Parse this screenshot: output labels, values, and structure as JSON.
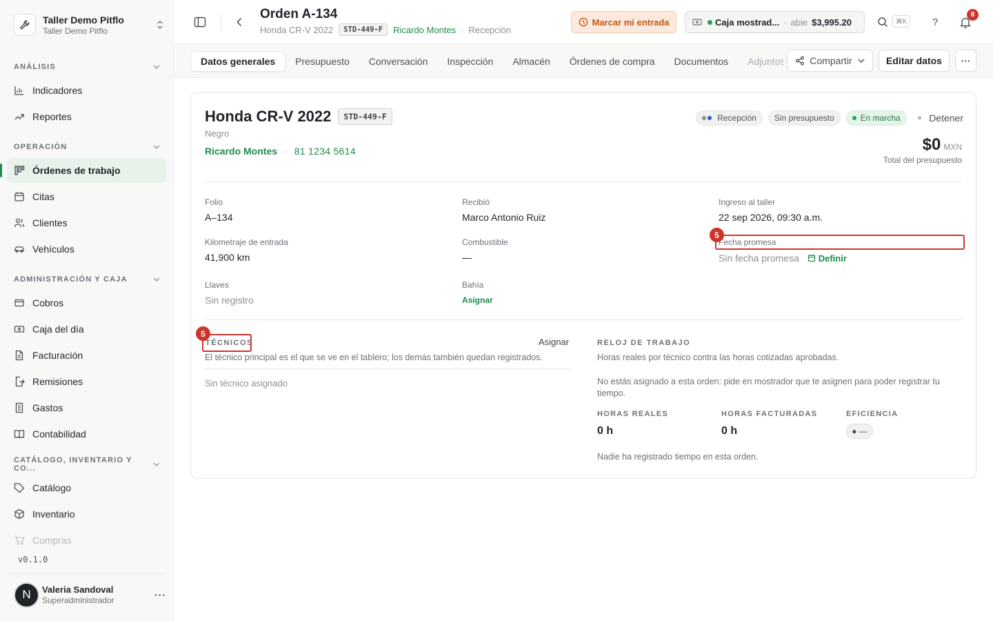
{
  "org": {
    "name": "Taller Demo Pitflo",
    "sub": "Taller Demo Pitflo"
  },
  "sidebar": {
    "sections": [
      {
        "title": "ANÁLISIS"
      },
      {
        "title": "OPERACIÓN"
      },
      {
        "title": "ADMINISTRACIÓN Y CAJA"
      },
      {
        "title": "CATÁLOGO, INVENTARIO Y CO..."
      }
    ],
    "items": [
      {
        "label": "Indicadores",
        "icon": "bar-chart-icon"
      },
      {
        "label": "Reportes",
        "icon": "trend-icon"
      },
      {
        "label": "Órdenes de trabajo",
        "icon": "kanban-icon"
      },
      {
        "label": "Citas",
        "icon": "calendar-icon"
      },
      {
        "label": "Clientes",
        "icon": "users-icon"
      },
      {
        "label": "Vehículos",
        "icon": "car-icon"
      },
      {
        "label": "Cobros",
        "icon": "wallet-icon"
      },
      {
        "label": "Caja del día",
        "icon": "cash-icon"
      },
      {
        "label": "Facturación",
        "icon": "invoice-icon"
      },
      {
        "label": "Remisiones",
        "icon": "export-doc-icon"
      },
      {
        "label": "Gastos",
        "icon": "receipt-icon"
      },
      {
        "label": "Contabilidad",
        "icon": "book-icon"
      },
      {
        "label": "Catálogo",
        "icon": "tag-icon"
      },
      {
        "label": "Inventario",
        "icon": "box-icon"
      },
      {
        "label": "Compras",
        "icon": "cart-icon"
      }
    ],
    "version": "v0.1.0"
  },
  "user": {
    "initial": "N",
    "name": "Valeria Sandoval",
    "role": "Superadministrador",
    "more": "···"
  },
  "header": {
    "title": "Orden A-134",
    "vehicle": "Honda CR-V 2022",
    "plate": "STD-449-F",
    "customer": "Ricardo Montes",
    "sep": "·",
    "stage": "Recepción",
    "entry_button": "Marcar mi entrada",
    "cash_name": "Caja mostrad...",
    "cash_dot_sep": "·",
    "cash_state": "abie",
    "cash_amount": "$3,995.20",
    "shortcut": "⌘K",
    "help": "?",
    "notifications": "8"
  },
  "tabs": [
    {
      "label": "Datos generales"
    },
    {
      "label": "Presupuesto"
    },
    {
      "label": "Conversación"
    },
    {
      "label": "Inspección"
    },
    {
      "label": "Almacén"
    },
    {
      "label": "Órdenes de compra"
    },
    {
      "label": "Documentos"
    },
    {
      "label": "Adjuntos"
    }
  ],
  "actions": {
    "share": "Compartir",
    "edit": "Editar datos",
    "more": "···"
  },
  "card": {
    "vehicle": "Honda CR-V 2022",
    "plate": "STD-449-F",
    "color": "Negro",
    "owner": "Ricardo Montes",
    "phone": "81 1234 5614",
    "chips": {
      "stage": "Recepción",
      "budget": "Sin presupuesto",
      "running": "En marcha"
    },
    "stop_icon": "⏸",
    "stop": "Detener",
    "total": "$0",
    "currency": "MXN",
    "total_label": "Total del presupuesto"
  },
  "fields": {
    "folio_label": "Folio",
    "folio": "A–134",
    "received_label": "Recibió",
    "received": "Marco Antonio Ruiz",
    "checkin_label": "Ingreso al taller",
    "checkin": "22 sep 2026, 09:30 a.m.",
    "km_label": "Kilometraje de entrada",
    "km": "41,900 km",
    "fuel_label": "Combustible",
    "fuel": "—",
    "promise_label": "Fecha promesa",
    "promise": "Sin fecha promesa",
    "promise_action": "Definir",
    "keys_label": "Llaves",
    "keys": "Sin registro",
    "bay_label": "Bahía",
    "bay_action": "Asignar"
  },
  "technicians": {
    "title": "TÉCNICOS",
    "assign": "Asignar",
    "desc": "El técnico principal es el que se ve en el tablero; los demás también quedan registrados.",
    "empty": "Sin técnico asignado"
  },
  "clock": {
    "title": "RELOJ DE TRABAJO",
    "desc": "Horas reales por técnico contra las horas cotizadas aprobadas.",
    "warning": "No estás asignado a esta orden: pide en mostrador que te asignen para poder registrar tu tiempo.",
    "real_label": "HORAS REALES",
    "real": "0 h",
    "billed_label": "HORAS FACTURADAS",
    "billed": "0 h",
    "eff_label": "EFICIENCIA",
    "eff": "● —",
    "no_time": "Nadie ha registrado tiempo en esta orden."
  },
  "annotations": {
    "badge_1": "5",
    "badge_2": "5"
  },
  "colors": {
    "accent": "#1f8a4c",
    "highlight": "#d0332b",
    "entry_bg": "#fde9dc"
  }
}
